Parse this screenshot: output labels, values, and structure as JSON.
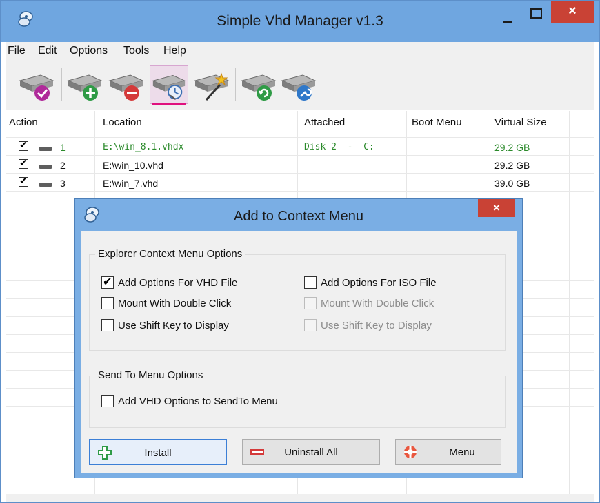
{
  "window": {
    "title": "Simple Vhd Manager v1.3",
    "close_symbol": "×"
  },
  "menu": {
    "items": [
      "File",
      "Edit",
      "Options",
      "Tools",
      "Help"
    ]
  },
  "toolbar": {
    "buttons": [
      {
        "icon": "disk-check-icon"
      },
      {
        "icon": "disk-add-icon"
      },
      {
        "icon": "disk-remove-icon"
      },
      {
        "icon": "disk-context-menu-icon",
        "active": true
      },
      {
        "icon": "disk-new-wand-icon"
      },
      {
        "icon": "disk-refresh-icon"
      },
      {
        "icon": "disk-settings-icon"
      }
    ]
  },
  "table": {
    "columns": [
      "Action",
      "Location",
      "Attached",
      "Boot Menu",
      "Virtual Size"
    ],
    "rows": [
      {
        "num": "1",
        "location": "E:\\win_8.1.vhdx",
        "attached": "Disk 2  -  C:",
        "boot": "",
        "size": "29.2 GB",
        "checked": true,
        "highlight": true
      },
      {
        "num": "2",
        "location": "E:\\win_10.vhd",
        "attached": "",
        "boot": "",
        "size": "29.2 GB",
        "checked": true,
        "highlight": false
      },
      {
        "num": "3",
        "location": "E:\\win_7.vhd",
        "attached": "",
        "boot": "",
        "size": "39.0 GB",
        "checked": true,
        "highlight": false
      }
    ]
  },
  "dialog": {
    "title": "Add to Context Menu",
    "close_symbol": "×",
    "explorer_group": {
      "title": "Explorer Context Menu Options",
      "vhd_options": [
        {
          "label": "Add Options For VHD File",
          "checked": true,
          "enabled": true
        },
        {
          "label": "Mount With Double Click",
          "checked": false,
          "enabled": true
        },
        {
          "label": "Use Shift Key to Display",
          "checked": false,
          "enabled": true
        }
      ],
      "iso_options": [
        {
          "label": "Add Options For ISO File",
          "checked": false,
          "enabled": true
        },
        {
          "label": "Mount With Double Click",
          "checked": false,
          "enabled": false
        },
        {
          "label": "Use Shift Key to Display",
          "checked": false,
          "enabled": false
        }
      ]
    },
    "sendto_group": {
      "title": "Send To Menu Options",
      "option": {
        "label": "Add VHD Options to SendTo Menu",
        "checked": false
      }
    },
    "buttons": {
      "install": "Install",
      "uninstall": "Uninstall All",
      "menu": "Menu"
    }
  },
  "colors": {
    "titlebar": "#6fa6e0",
    "close": "#c94235",
    "highlight_text": "#2b8a2b",
    "active_underline": "#e0117e"
  }
}
